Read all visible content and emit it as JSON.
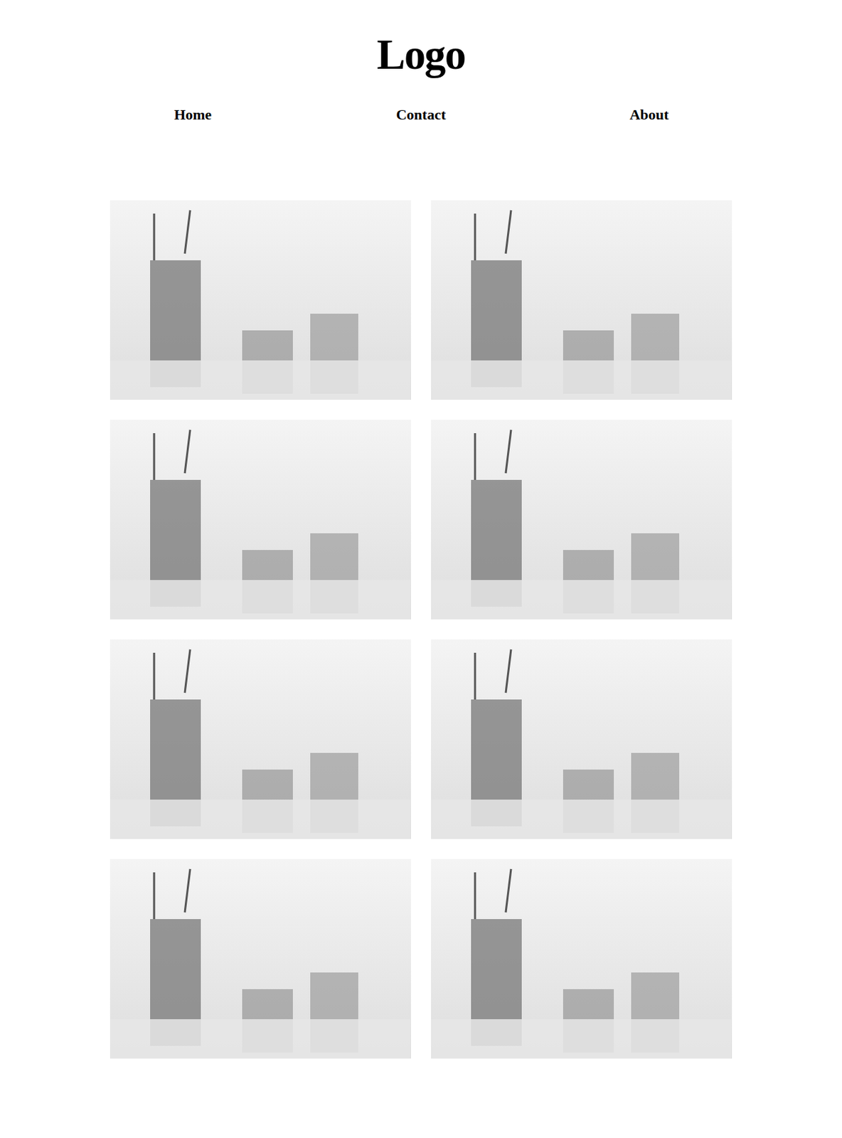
{
  "header": {
    "logo": "Logo"
  },
  "nav": [
    {
      "label": "Home"
    },
    {
      "label": "Contact"
    },
    {
      "label": "About"
    }
  ],
  "gallery": [
    {
      "kind": "photo"
    },
    {
      "kind": "photo"
    },
    {
      "kind": "photo"
    },
    {
      "kind": "photo"
    },
    {
      "kind": "photo"
    },
    {
      "kind": "photo"
    },
    {
      "kind": "photo"
    },
    {
      "kind": "photo"
    }
  ]
}
